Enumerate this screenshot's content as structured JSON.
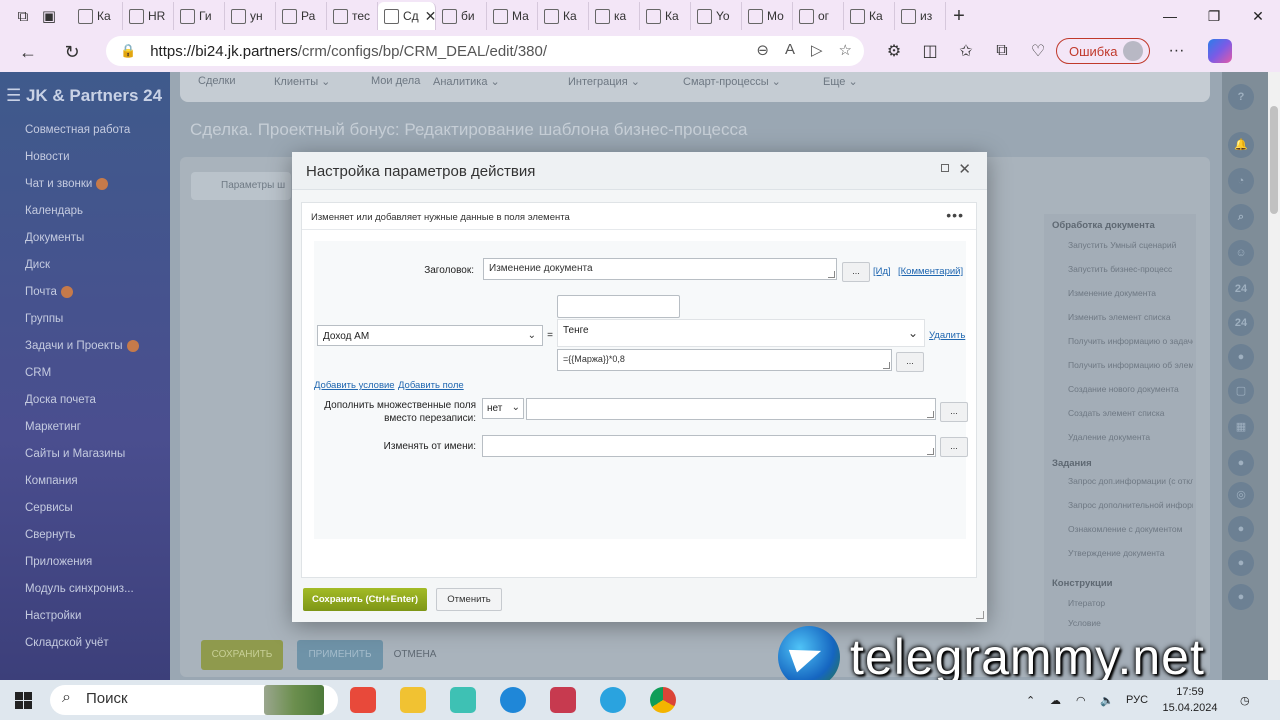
{
  "browser": {
    "tabs": [
      {
        "label": "Ка"
      },
      {
        "label": "HR"
      },
      {
        "label": "Ги"
      },
      {
        "label": "ун"
      },
      {
        "label": "Ра"
      },
      {
        "label": "тес"
      },
      {
        "label": "Сд",
        "active": true
      },
      {
        "label": "би"
      },
      {
        "label": "Ма"
      },
      {
        "label": "Ка"
      },
      {
        "label": "ка"
      },
      {
        "label": "Ка"
      },
      {
        "label": "Yo"
      },
      {
        "label": "Мо"
      },
      {
        "label": "ог"
      },
      {
        "label": "Ка"
      },
      {
        "label": "из"
      }
    ],
    "url_host": "https://bi24.jk.partners",
    "url_path": "/crm/configs/bp/CRM_DEAL/edit/380/",
    "error_label": "Ошибка"
  },
  "app": {
    "logo": "JK & Partners 24",
    "menu": [
      {
        "label": "Совместная работа"
      },
      {
        "label": "Новости"
      },
      {
        "label": "Чат и звонки",
        "badge": true
      },
      {
        "label": "Календарь"
      },
      {
        "label": "Документы"
      },
      {
        "label": "Диск"
      },
      {
        "label": "Почта",
        "badge": true
      },
      {
        "label": "Группы"
      },
      {
        "label": "Задачи и Проекты",
        "badge": true
      },
      {
        "label": "CRM"
      },
      {
        "label": "Доска почета"
      },
      {
        "label": "Маркетинг"
      },
      {
        "label": "Сайты и Магазины"
      },
      {
        "label": "Компания"
      },
      {
        "label": "Сервисы"
      },
      {
        "label": "Свернуть"
      },
      {
        "label": "Приложения"
      },
      {
        "label": "Модуль синхрониз..."
      },
      {
        "label": "Настройки"
      },
      {
        "label": "Складской учёт"
      }
    ],
    "topnav": [
      "Сделки",
      "Клиенты ⌄",
      "Мои дела",
      "Аналитика ⌄",
      "Интеграция ⌄",
      "Смарт-процессы ⌄",
      "Еще ⌄"
    ],
    "page_title": "Сделка. Проектный бонус: Редактирование шаблона бизнес-процесса",
    "inner_tab": "Параметры ш",
    "right_panel": {
      "group1": "Обработка документа",
      "group1_items": [
        "Запустить Умный сценарий",
        "Запустить бизнес-процесс",
        "Изменение документа",
        "Изменить элемент списка",
        "Получить информацию о задаче",
        "Получить информацию об элементе списка",
        "Создание нового документа",
        "Создать элемент списка",
        "Удаление документа"
      ],
      "group2": "Задания",
      "group2_items": [
        "Запрос доп.информации (с отклонением)",
        "Запрос дополнительной информации",
        "Ознакомление с документом",
        "Утверждение документа"
      ],
      "group3": "Конструкции",
      "group3_items": [
        "Итератор",
        "Условие"
      ]
    },
    "bottom_buttons": {
      "save": "СОХРАНИТЬ",
      "apply": "ПРИМЕНИТЬ",
      "cancel": "ОТМЕНА"
    }
  },
  "dialog": {
    "title": "Настройка параметров действия",
    "description": "Изменяет или добавляет нужные данные в поля элемента",
    "heading_label": "Заголовок:",
    "heading_value": "Изменение документа",
    "link_id": "[Ид]",
    "link_comment": "[Комментарий]",
    "field_select": "Доход АМ",
    "equals": "=",
    "currency": "Тенге",
    "formula": "={{Маржа}}*0,8",
    "delete_link": "Удалить",
    "add_condition": "Добавить условие",
    "add_field": "Добавить поле",
    "append_label": "Дополнить множественные поля вместо перезаписи:",
    "append_value": "нет",
    "run_as_label": "Изменять от имени:",
    "dots": "...",
    "save_button": "Сохранить (Ctrl+Enter)",
    "cancel_button": "Отменить"
  },
  "watermark": "telegrammy.net",
  "taskbar": {
    "search_placeholder": "Поиск",
    "language": "РУС",
    "time": "17:59",
    "date": "15.04.2024"
  }
}
